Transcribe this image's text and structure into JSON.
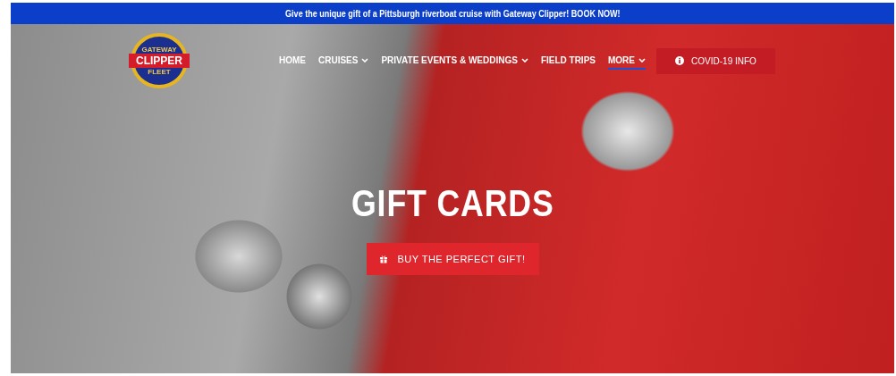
{
  "banner": {
    "text": "Give the unique gift of a Pittsburgh riverboat cruise with Gateway Clipper! **BOOK NOW!**"
  },
  "logo": {
    "top": "GATEWAY",
    "middle": "CLIPPER",
    "bottom": "FLEET"
  },
  "nav": [
    {
      "label": "HOME",
      "dropdown": false,
      "selected": false
    },
    {
      "label": "CRUISES",
      "dropdown": true,
      "selected": false
    },
    {
      "label": "PRIVATE EVENTS & WEDDINGS",
      "dropdown": true,
      "selected": false
    },
    {
      "label": "FIELD TRIPS",
      "dropdown": false,
      "selected": false
    },
    {
      "label": "MORE",
      "dropdown": true,
      "selected": true
    }
  ],
  "covid_button": {
    "label": "COVID-19 INFO"
  },
  "hero": {
    "title": "GIFT CARDS",
    "button": "BUY THE PERFECT GIFT!"
  }
}
